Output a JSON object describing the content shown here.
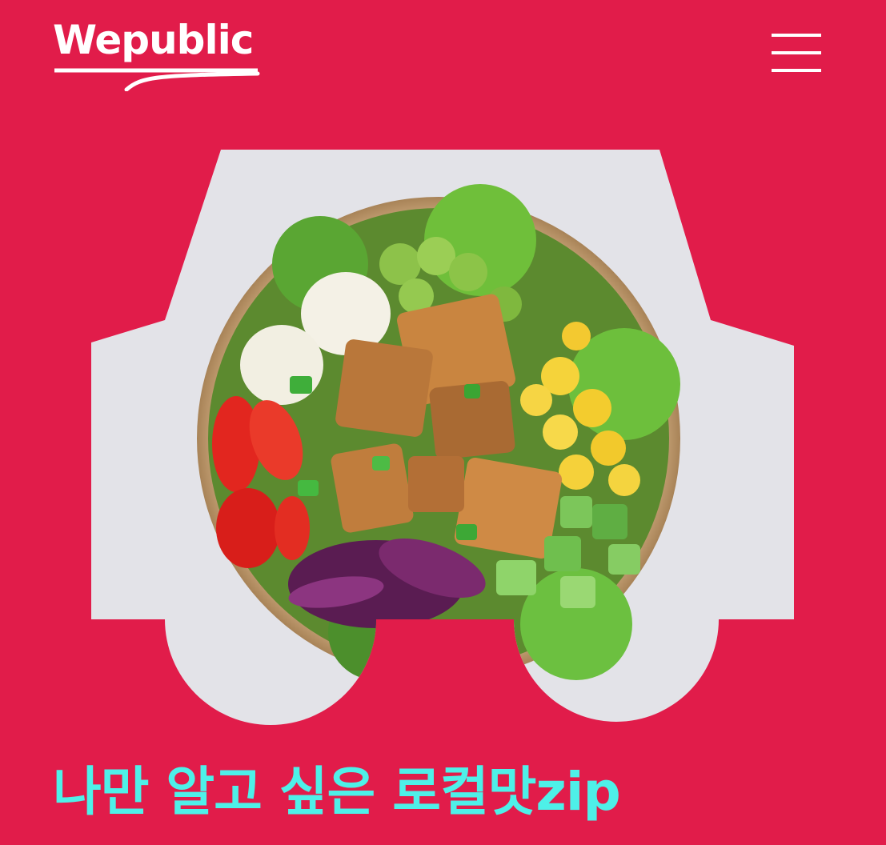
{
  "header": {
    "logo_text": "Wepublic",
    "menu_icon": "hamburger-menu-icon"
  },
  "hero": {
    "image_subject": "salad-bowl",
    "image_shape": "car-silhouette"
  },
  "main": {
    "title": "나만 알고 싶은 로컬맛zip"
  },
  "colors": {
    "background": "#e11c4a",
    "title": "#4ef0e8",
    "logo": "#ffffff",
    "photo_backdrop": "#e3e3e8"
  }
}
